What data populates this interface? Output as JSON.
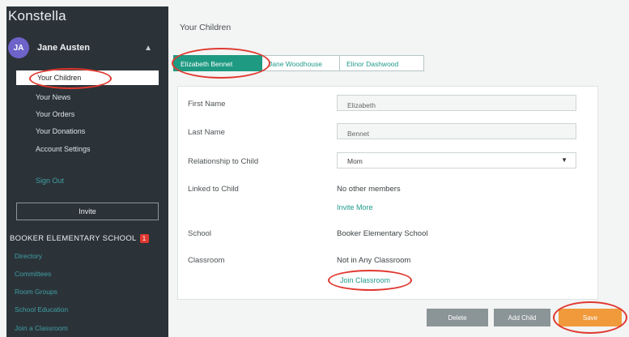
{
  "sidebar": {
    "brand": "Konstella",
    "user": {
      "name": "Jane Austen",
      "initials": "JA"
    },
    "menu": [
      "Your Children",
      "Your News",
      "Your Orders",
      "Your Donations",
      "Account Settings"
    ],
    "sign_out": "Sign Out",
    "invite": "Invite",
    "school": {
      "name": "BOOKER ELEMENTARY SCHOOL",
      "badge": "1"
    },
    "school_links": [
      "Directory",
      "Committees",
      "Room Groups",
      "School Education",
      "Join a Classroom"
    ]
  },
  "main": {
    "title": "Your Children",
    "tabs": [
      "Elizabeth Bennet",
      "Jane Woodhouse",
      "Elinor Dashwood"
    ],
    "form": {
      "first_name": {
        "label": "First Name",
        "value": "Elizabeth"
      },
      "last_name": {
        "label": "Last Name",
        "value": "Bennet"
      },
      "relationship": {
        "label": "Relationship to Child",
        "value": "Mom"
      },
      "linked": {
        "label": "Linked to Child",
        "value": "No other members",
        "link": "Invite More"
      },
      "school": {
        "label": "School",
        "value": "Booker Elementary School"
      },
      "classroom": {
        "label": "Classroom",
        "value": "Not in Any Classroom",
        "link": "Join Classroom"
      }
    },
    "buttons": {
      "delete": "Delete",
      "add_child": "Add Child",
      "save": "Save"
    }
  }
}
